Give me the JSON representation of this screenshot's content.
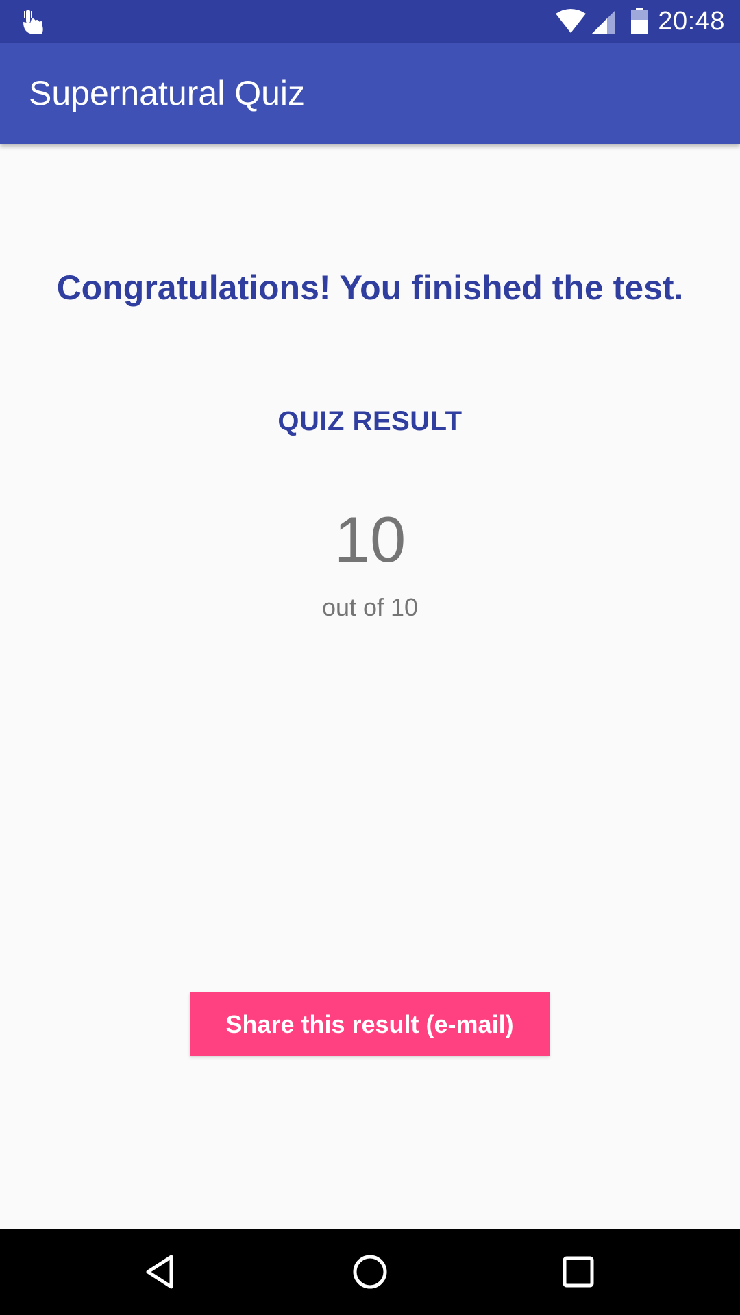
{
  "status_bar": {
    "time": "20:48",
    "icons": [
      "touch-notification-icon",
      "wifi-icon",
      "cell-signal-icon",
      "battery-icon"
    ]
  },
  "app_bar": {
    "title": "Supernatural Quiz"
  },
  "result": {
    "message": "Congratulations! You finished the test.",
    "heading": "QUIZ RESULT",
    "score": "10",
    "out_of": "out of 10"
  },
  "actions": {
    "share_label": "Share this result (e-mail)"
  },
  "nav_bar": {
    "buttons": [
      "back-icon",
      "home-icon",
      "recents-icon"
    ]
  },
  "colors": {
    "status_bar": "#303F9F",
    "app_bar": "#3F51B5",
    "accent": "#FF4081",
    "text_primary": "#303F9F",
    "text_secondary": "#757575",
    "background": "#FAFAFA"
  }
}
